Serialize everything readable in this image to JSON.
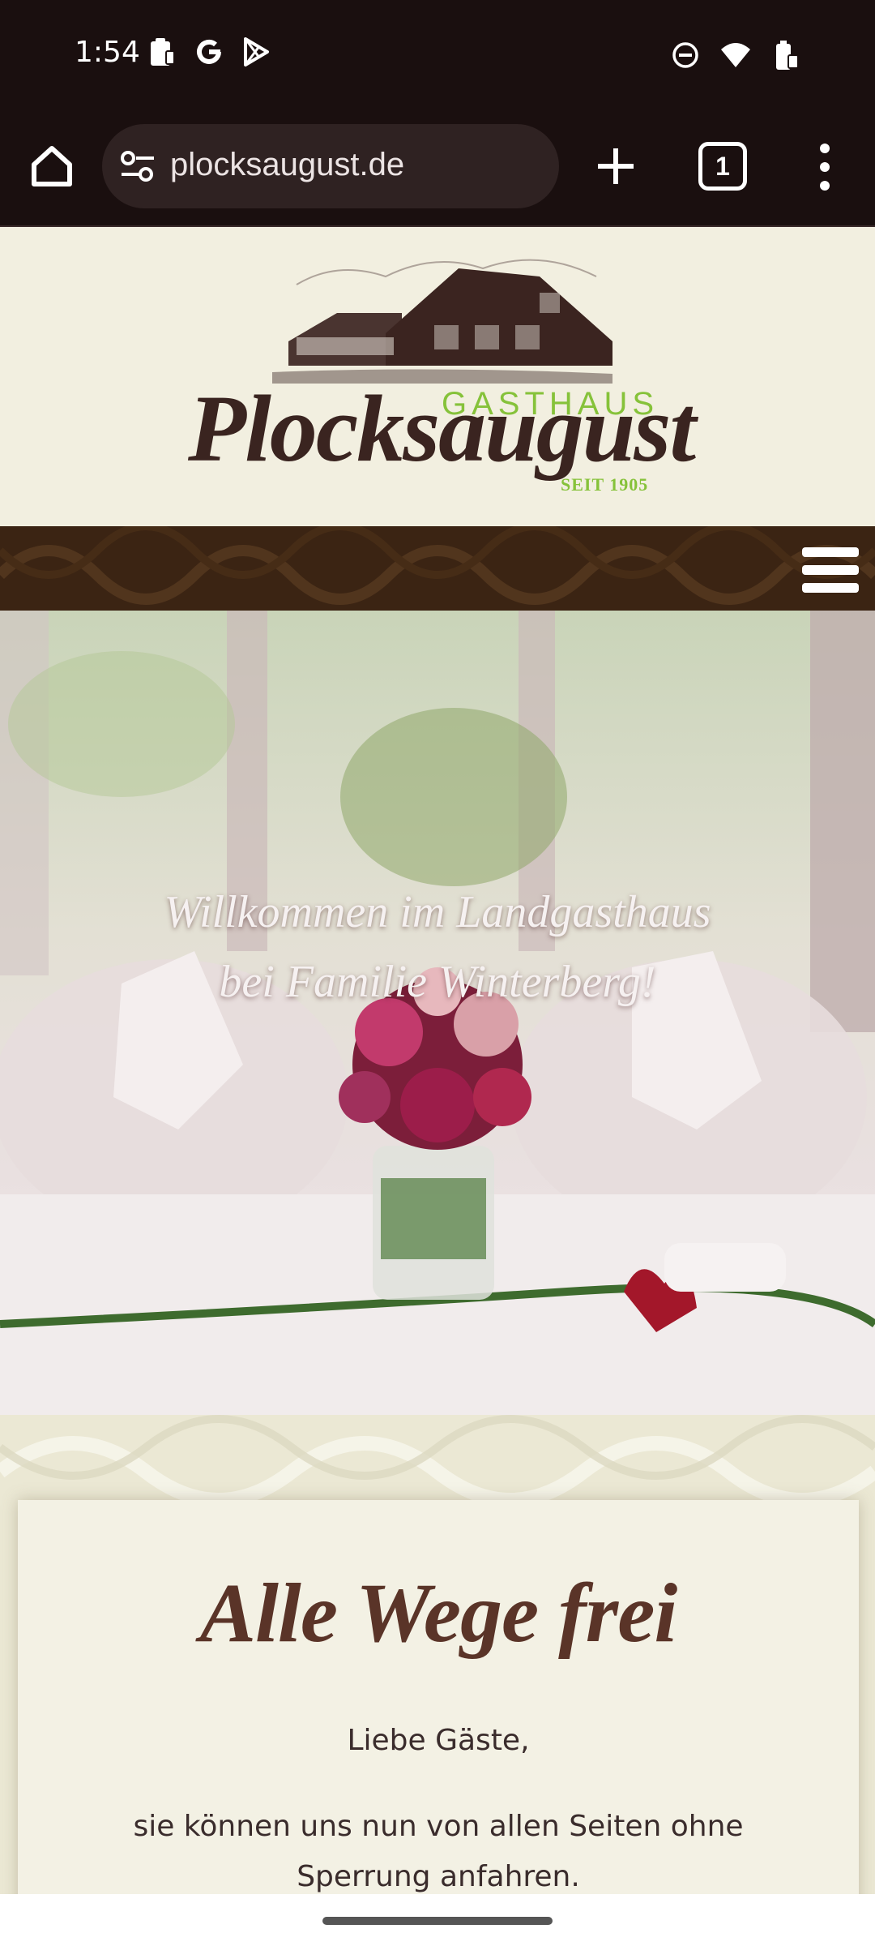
{
  "status_bar": {
    "time": "1:54",
    "left_icons": [
      "clipboard-icon",
      "google-icon",
      "play-store-icon"
    ],
    "right_icons": [
      "do-not-disturb-icon",
      "wifi-icon",
      "battery-icon"
    ]
  },
  "browser": {
    "url": "plocksaugust.de",
    "tab_count": "1"
  },
  "site": {
    "logo": {
      "brand_top": "GASTHAUS",
      "brand_name": "Plocksaugust",
      "since": "SEIT 1905"
    },
    "hero": {
      "line1": "Willkommen im Landgasthaus",
      "line2": "bei Familie Winterberg!"
    },
    "content": {
      "title": "Alle Wege frei",
      "greeting": "Liebe Gäste,",
      "body": "sie können uns nun von allen Seiten ohne Sperrung anfahren."
    }
  },
  "colors": {
    "chrome_bg": "#1a0f0f",
    "accent_green": "#86c23a",
    "brown": "#3b2413",
    "cream": "#f3f1e4"
  }
}
